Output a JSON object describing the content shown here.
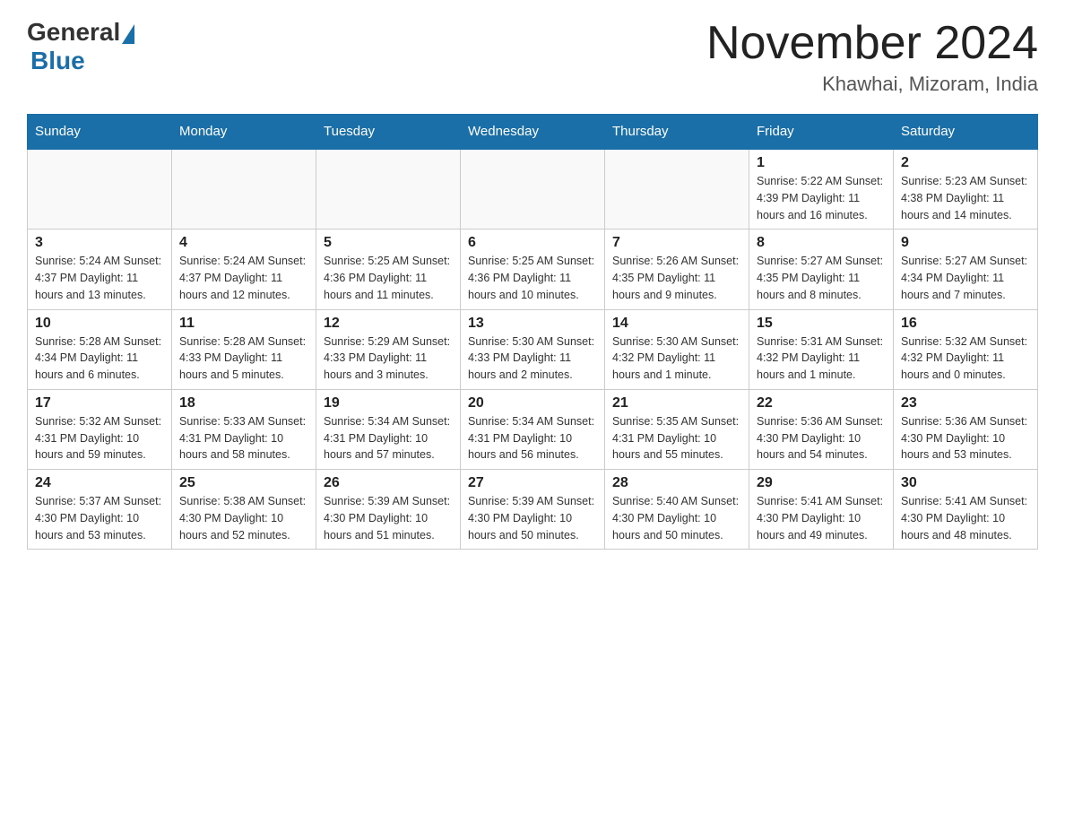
{
  "header": {
    "logo": {
      "general": "General",
      "blue": "Blue"
    },
    "title": "November 2024",
    "location": "Khawhai, Mizoram, India"
  },
  "calendar": {
    "days_of_week": [
      "Sunday",
      "Monday",
      "Tuesday",
      "Wednesday",
      "Thursday",
      "Friday",
      "Saturday"
    ],
    "weeks": [
      {
        "days": [
          {
            "number": "",
            "info": ""
          },
          {
            "number": "",
            "info": ""
          },
          {
            "number": "",
            "info": ""
          },
          {
            "number": "",
            "info": ""
          },
          {
            "number": "",
            "info": ""
          },
          {
            "number": "1",
            "info": "Sunrise: 5:22 AM\nSunset: 4:39 PM\nDaylight: 11 hours and 16 minutes."
          },
          {
            "number": "2",
            "info": "Sunrise: 5:23 AM\nSunset: 4:38 PM\nDaylight: 11 hours and 14 minutes."
          }
        ]
      },
      {
        "days": [
          {
            "number": "3",
            "info": "Sunrise: 5:24 AM\nSunset: 4:37 PM\nDaylight: 11 hours and 13 minutes."
          },
          {
            "number": "4",
            "info": "Sunrise: 5:24 AM\nSunset: 4:37 PM\nDaylight: 11 hours and 12 minutes."
          },
          {
            "number": "5",
            "info": "Sunrise: 5:25 AM\nSunset: 4:36 PM\nDaylight: 11 hours and 11 minutes."
          },
          {
            "number": "6",
            "info": "Sunrise: 5:25 AM\nSunset: 4:36 PM\nDaylight: 11 hours and 10 minutes."
          },
          {
            "number": "7",
            "info": "Sunrise: 5:26 AM\nSunset: 4:35 PM\nDaylight: 11 hours and 9 minutes."
          },
          {
            "number": "8",
            "info": "Sunrise: 5:27 AM\nSunset: 4:35 PM\nDaylight: 11 hours and 8 minutes."
          },
          {
            "number": "9",
            "info": "Sunrise: 5:27 AM\nSunset: 4:34 PM\nDaylight: 11 hours and 7 minutes."
          }
        ]
      },
      {
        "days": [
          {
            "number": "10",
            "info": "Sunrise: 5:28 AM\nSunset: 4:34 PM\nDaylight: 11 hours and 6 minutes."
          },
          {
            "number": "11",
            "info": "Sunrise: 5:28 AM\nSunset: 4:33 PM\nDaylight: 11 hours and 5 minutes."
          },
          {
            "number": "12",
            "info": "Sunrise: 5:29 AM\nSunset: 4:33 PM\nDaylight: 11 hours and 3 minutes."
          },
          {
            "number": "13",
            "info": "Sunrise: 5:30 AM\nSunset: 4:33 PM\nDaylight: 11 hours and 2 minutes."
          },
          {
            "number": "14",
            "info": "Sunrise: 5:30 AM\nSunset: 4:32 PM\nDaylight: 11 hours and 1 minute."
          },
          {
            "number": "15",
            "info": "Sunrise: 5:31 AM\nSunset: 4:32 PM\nDaylight: 11 hours and 1 minute."
          },
          {
            "number": "16",
            "info": "Sunrise: 5:32 AM\nSunset: 4:32 PM\nDaylight: 11 hours and 0 minutes."
          }
        ]
      },
      {
        "days": [
          {
            "number": "17",
            "info": "Sunrise: 5:32 AM\nSunset: 4:31 PM\nDaylight: 10 hours and 59 minutes."
          },
          {
            "number": "18",
            "info": "Sunrise: 5:33 AM\nSunset: 4:31 PM\nDaylight: 10 hours and 58 minutes."
          },
          {
            "number": "19",
            "info": "Sunrise: 5:34 AM\nSunset: 4:31 PM\nDaylight: 10 hours and 57 minutes."
          },
          {
            "number": "20",
            "info": "Sunrise: 5:34 AM\nSunset: 4:31 PM\nDaylight: 10 hours and 56 minutes."
          },
          {
            "number": "21",
            "info": "Sunrise: 5:35 AM\nSunset: 4:31 PM\nDaylight: 10 hours and 55 minutes."
          },
          {
            "number": "22",
            "info": "Sunrise: 5:36 AM\nSunset: 4:30 PM\nDaylight: 10 hours and 54 minutes."
          },
          {
            "number": "23",
            "info": "Sunrise: 5:36 AM\nSunset: 4:30 PM\nDaylight: 10 hours and 53 minutes."
          }
        ]
      },
      {
        "days": [
          {
            "number": "24",
            "info": "Sunrise: 5:37 AM\nSunset: 4:30 PM\nDaylight: 10 hours and 53 minutes."
          },
          {
            "number": "25",
            "info": "Sunrise: 5:38 AM\nSunset: 4:30 PM\nDaylight: 10 hours and 52 minutes."
          },
          {
            "number": "26",
            "info": "Sunrise: 5:39 AM\nSunset: 4:30 PM\nDaylight: 10 hours and 51 minutes."
          },
          {
            "number": "27",
            "info": "Sunrise: 5:39 AM\nSunset: 4:30 PM\nDaylight: 10 hours and 50 minutes."
          },
          {
            "number": "28",
            "info": "Sunrise: 5:40 AM\nSunset: 4:30 PM\nDaylight: 10 hours and 50 minutes."
          },
          {
            "number": "29",
            "info": "Sunrise: 5:41 AM\nSunset: 4:30 PM\nDaylight: 10 hours and 49 minutes."
          },
          {
            "number": "30",
            "info": "Sunrise: 5:41 AM\nSunset: 4:30 PM\nDaylight: 10 hours and 48 minutes."
          }
        ]
      }
    ]
  }
}
